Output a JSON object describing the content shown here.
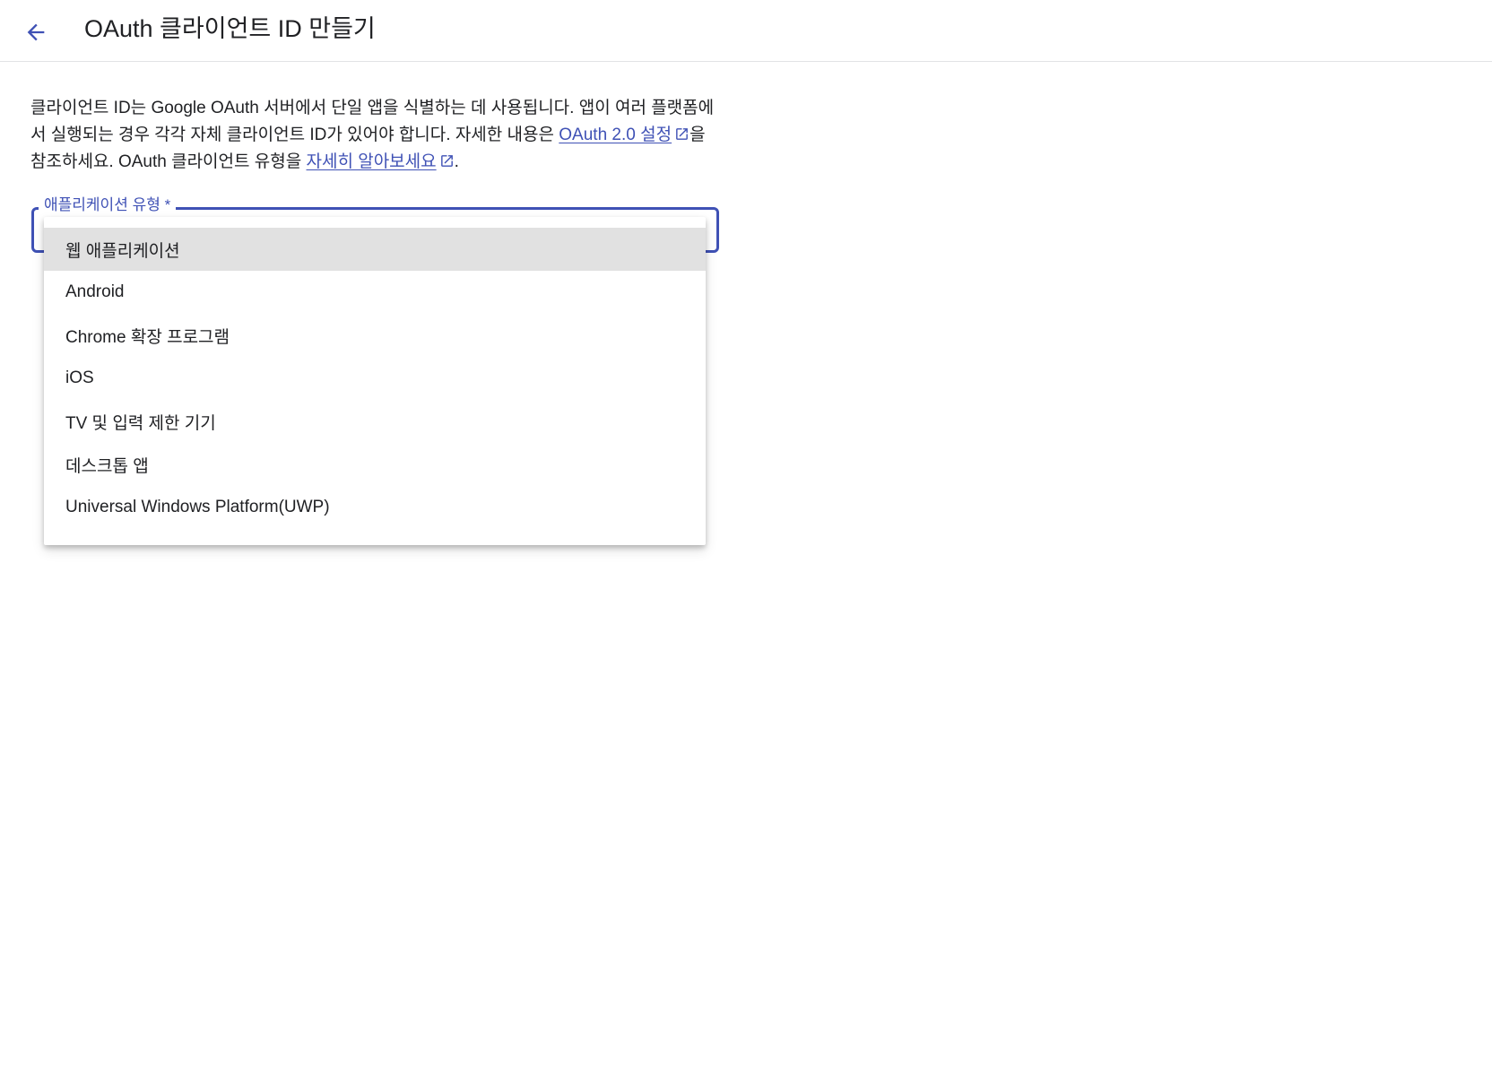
{
  "header": {
    "title": "OAuth 클라이언트 ID 만들기",
    "back_icon": "arrow-back-icon"
  },
  "description": {
    "text_1": "클라이언트 ID는 Google OAuth 서버에서 단일 앱을 식별하는 데 사용됩니다. 앱이 여러 플랫폼에서 실행되는 경우 각각 자체 클라이언트 ID가 있어야 합니다. 자세한 내용은 ",
    "link_1": "OAuth 2.0 설정",
    "text_2": "을 참조하세요. OAuth 클라이언트 유형을 ",
    "link_2": "자세히 알아보세요",
    "text_3": ".",
    "link_icon": "open-in-new-icon"
  },
  "select": {
    "label": "애플리케이션 유형 *",
    "options": [
      "웹 애플리케이션",
      "Android",
      "Chrome 확장 프로그램",
      "iOS",
      "TV 및 입력 제한 기기",
      "데스크톱 앱",
      "Universal Windows Platform(UWP)"
    ],
    "highlighted_index": 0
  },
  "colors": {
    "accent": "#3f51b5",
    "highlight": "#e1e1e1",
    "text": "#202124"
  }
}
